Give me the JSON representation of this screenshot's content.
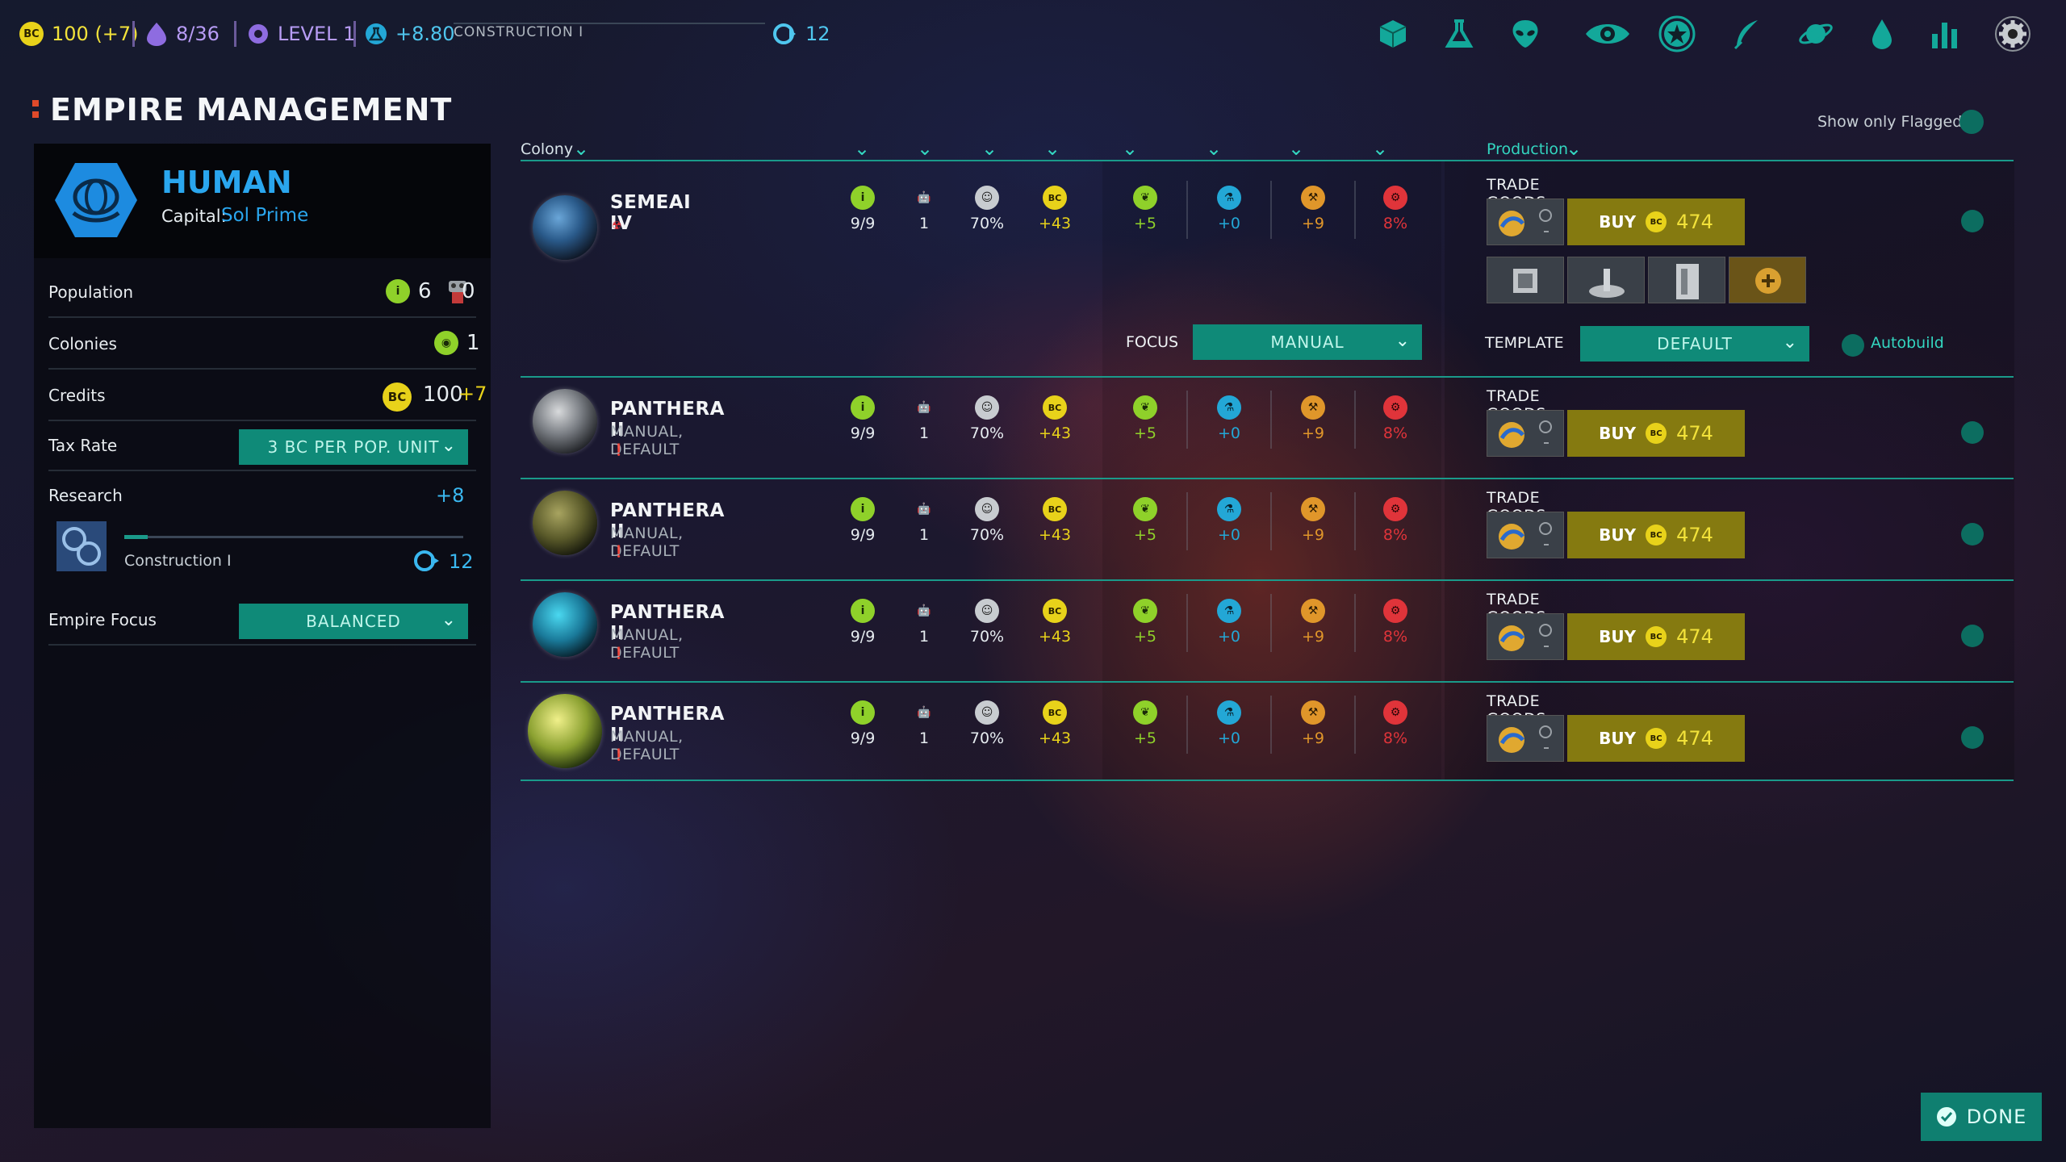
{
  "topbar": {
    "credits": "100 (+7)",
    "credits_icon": "BC",
    "command": "8/36",
    "level": "LEVEL 1",
    "research_rate": "+8.80",
    "research_name": "CONSTRUCTION I",
    "turns": "12",
    "icons": [
      "cube-icon",
      "flask-icon",
      "alien-icon",
      "eye-icon",
      "star-icon",
      "quill-icon",
      "planet-icon",
      "drop-icon",
      "bar-chart-icon",
      "gear-icon"
    ]
  },
  "page_title": "EMPIRE MANAGEMENT",
  "show_only_flagged": "Show only Flagged",
  "empire": {
    "race": "HUMAN",
    "capital_label": "Capital:",
    "capital": "Sol Prime",
    "population_label": "Population",
    "population": "6",
    "population_other": "0",
    "colonies_label": "Colonies",
    "colonies": "1",
    "credits_label": "Credits",
    "credits": "100",
    "credits_delta": "+7",
    "tax_label": "Tax Rate",
    "tax_value": "3 BC PER POP. UNIT",
    "research_label": "Research",
    "research_delta": "+8",
    "research_name": "Construction I",
    "research_turns": "12",
    "research_progress": 0.07,
    "focus_label": "Empire Focus",
    "focus_value": "BALANCED"
  },
  "table": {
    "colony_header": "Colony",
    "production_header": "Production",
    "focus_label": "FOCUS",
    "focus_value": "MANUAL",
    "template_label": "TEMPLATE",
    "template_value": "DEFAULT",
    "autobuild_label": "Autobuild",
    "trade_goods": "TRADE GOODS",
    "buy_label": "BUY",
    "rows": [
      {
        "name": "SEMEAI IV",
        "sub": "",
        "pop": "9/9",
        "workers": "1",
        "approval": "70%",
        "credits": "+43",
        "food": "+5",
        "research": "+0",
        "industry": "+9",
        "defense": "8%",
        "buy": "474"
      },
      {
        "name": "PANTHERA II",
        "sub": "MANUAL, DEFAULT",
        "pop": "9/9",
        "workers": "1",
        "approval": "70%",
        "credits": "+43",
        "food": "+5",
        "research": "+0",
        "industry": "+9",
        "defense": "8%",
        "buy": "474"
      },
      {
        "name": "PANTHERA II",
        "sub": "MANUAL, DEFAULT",
        "pop": "9/9",
        "workers": "1",
        "approval": "70%",
        "credits": "+43",
        "food": "+5",
        "research": "+0",
        "industry": "+9",
        "defense": "8%",
        "buy": "474"
      },
      {
        "name": "PANTHERA II",
        "sub": "MANUAL, DEFAULT",
        "pop": "9/9",
        "workers": "1",
        "approval": "70%",
        "credits": "+43",
        "food": "+5",
        "research": "+0",
        "industry": "+9",
        "defense": "8%",
        "buy": "474"
      },
      {
        "name": "PANTHERA II",
        "sub": "MANUAL, DEFAULT",
        "pop": "9/9",
        "workers": "1",
        "approval": "70%",
        "credits": "+43",
        "food": "+5",
        "research": "+0",
        "industry": "+9",
        "defense": "8%",
        "buy": "474"
      }
    ]
  },
  "done_label": "DONE",
  "colors": {
    "accent": "#1a9a8a",
    "teal_button": "#0f8a78",
    "buy": "#857a10",
    "coin": "#e8d21a",
    "food": "#8fd12a",
    "research": "#23a7d6",
    "industry": "#e0962a",
    "defense": "#e0343a"
  }
}
